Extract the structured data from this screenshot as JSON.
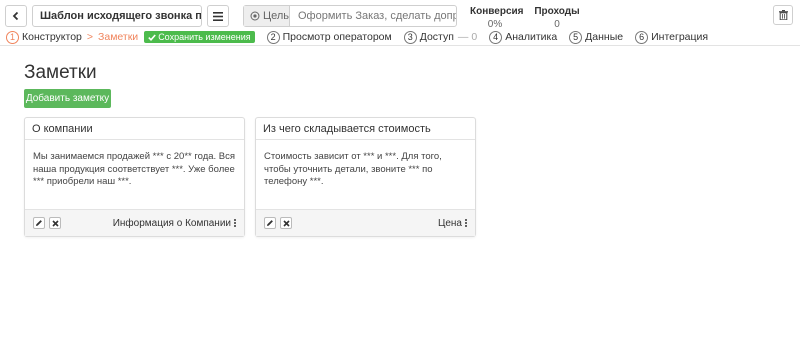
{
  "header": {
    "title": "Шаблон исходящего звонка по заяв",
    "goal_label": "Цель",
    "goal_placeholder": "Оформить Заказ, сделать допродажу",
    "conversion_label": "Конверсия",
    "conversion_value": "0%",
    "passes_label": "Проходы",
    "passes_value": "0"
  },
  "steps": {
    "constructor": {
      "num": "1",
      "label": "Конструктор"
    },
    "separator": ">",
    "current": "Заметки",
    "save_badge": "Сохранить изменения",
    "operator_view": {
      "num": "2",
      "label": "Просмотр оператором"
    },
    "access": {
      "num": "3",
      "label": "Доступ",
      "extra": "— 0"
    },
    "analytics": {
      "num": "4",
      "label": "Аналитика"
    },
    "data": {
      "num": "5",
      "label": "Данные"
    },
    "integration": {
      "num": "6",
      "label": "Интеграция"
    }
  },
  "main": {
    "title": "Заметки",
    "add_button": "Добавить заметку",
    "notes": [
      {
        "title": "О компании",
        "body": "Мы занимаемся продажей *** с 20** года. Вся наша продукция соответствует ***. Уже более *** приобрели наш ***.",
        "footer": "Информация о Компании"
      },
      {
        "title": "Из чего складывается стоимость",
        "body": "Стоимость зависит от *** и ***. Для того, чтобы уточнить детали, звоните *** по телефону ***.",
        "footer": "Цена"
      }
    ]
  },
  "icons": {
    "back": "chevron-left-icon",
    "menu": "hamburger-icon",
    "goal": "target-icon",
    "trash": "trash-icon",
    "save_check": "check-icon",
    "edit": "pencil-icon",
    "delete": "close-icon",
    "more": "kebab-icon"
  },
  "colors": {
    "accent_orange": "#f0845c",
    "save_green": "#4cbb4c",
    "add_button_green": "#5cb85c"
  }
}
